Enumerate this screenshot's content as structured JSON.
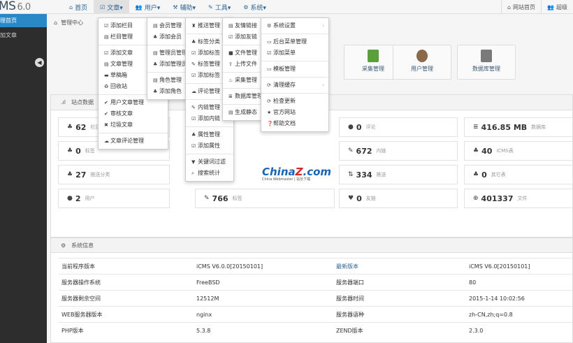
{
  "logo": {
    "name": "MS",
    "version": "6.0"
  },
  "topnav": [
    {
      "icon": "⌂",
      "label": "首页",
      "active": false
    },
    {
      "icon": "☑",
      "label": "文章▾",
      "active": true
    },
    {
      "icon": "👥",
      "label": "用户▾",
      "active": false
    },
    {
      "icon": "⚒",
      "label": "辅助▾",
      "active": false
    },
    {
      "icon": "✎",
      "label": "工具▾",
      "active": false
    },
    {
      "icon": "⚙",
      "label": "系统▾",
      "active": false
    }
  ],
  "topright": [
    {
      "icon": "⌂",
      "label": "网站首页"
    },
    {
      "icon": "👥",
      "label": "超级"
    }
  ],
  "sidebar": [
    {
      "label": "理首页",
      "active": true
    },
    {
      "label": "加文章",
      "active": false
    }
  ],
  "breadcrumb": "管理中心",
  "tiles": [
    {
      "label": "采集管理",
      "color": "#5a9f3c"
    },
    {
      "label": "用户管理",
      "color": "#8a6a4a"
    },
    {
      "label": "数据库管理",
      "color": "#7a7a7a"
    }
  ],
  "stats_panel_title": "站点数据",
  "stats": [
    {
      "icon": "♣",
      "value": "62",
      "label": "栏目"
    },
    {
      "icon": "●",
      "value": "0",
      "label": "评论"
    },
    {
      "icon": "≣",
      "value": "416.85 MB",
      "label": "数据库"
    },
    {
      "icon": "♣",
      "value": "0",
      "label": "标签"
    },
    {
      "icon": "✎",
      "value": "672",
      "label": "内链"
    },
    {
      "icon": "♣",
      "value": "40",
      "label": "iCMS表"
    },
    {
      "icon": "♣",
      "value": "27",
      "label": "推送分类"
    },
    {
      "icon": "⇅",
      "value": "334",
      "label": "推送"
    },
    {
      "icon": "♣",
      "value": "0",
      "label": "其它表"
    },
    {
      "icon": "●",
      "value": "2",
      "label": "用户"
    },
    {
      "icon": "✎",
      "value": "766",
      "label": "标签"
    },
    {
      "icon": "♥",
      "value": "0",
      "label": "友链"
    },
    {
      "icon": "⊕",
      "value": "401337",
      "label": "文件"
    }
  ],
  "sysinfo_title": "系统信息",
  "sysinfo": [
    [
      "当前程序版本",
      "iCMS V6.0.0[20150101]",
      "最新版本",
      "iCMS V6.0[20150101]"
    ],
    [
      "服务器操作系统",
      "FreeBSD",
      "服务器端口",
      "80"
    ],
    [
      "服务器剩余空间",
      "12512M",
      "服务器时间",
      "2015-1-14 10:02:56"
    ],
    [
      "WEB服务器版本",
      "nginx",
      "服务器语种",
      "zh-CN,zh;q=0.8"
    ],
    [
      "PHP版本",
      "5.3.8",
      "ZEND版本",
      "2.3.0"
    ]
  ],
  "menus": {
    "article": [
      {
        "icon": "☑",
        "label": "添加栏目"
      },
      {
        "icon": "▤",
        "label": "栏目管理"
      },
      {
        "sep": true
      },
      {
        "icon": "☑",
        "label": "添加文章"
      },
      {
        "icon": "▤",
        "label": "文章管理"
      },
      {
        "icon": "▬",
        "label": "草稿箱"
      },
      {
        "icon": "♻",
        "label": "回收站"
      },
      {
        "sep": true
      },
      {
        "icon": "✔",
        "label": "用户文章管理"
      },
      {
        "icon": "✔",
        "label": "审核文章"
      },
      {
        "icon": "✖",
        "label": "垃圾文章"
      },
      {
        "sep": true
      },
      {
        "icon": "☁",
        "label": "文章评论管理"
      }
    ],
    "user": [
      {
        "icon": "▤",
        "label": "会员管理"
      },
      {
        "icon": "♣",
        "label": "添加会员"
      },
      {
        "sep": true
      },
      {
        "icon": "▤",
        "label": "管理员管理"
      },
      {
        "icon": "♣",
        "label": "添加管理员"
      },
      {
        "sep": true
      },
      {
        "icon": "▤",
        "label": "角色管理"
      },
      {
        "icon": "♣",
        "label": "添加角色"
      }
    ],
    "helper": [
      {
        "icon": "♜",
        "label": "推送管理"
      },
      {
        "sep": true
      },
      {
        "icon": "♣",
        "label": "标签分类"
      },
      {
        "icon": "☑",
        "label": "添加标签"
      },
      {
        "icon": "✎",
        "label": "标签管理"
      },
      {
        "icon": "☑",
        "label": "添加标签"
      },
      {
        "sep": true
      },
      {
        "icon": "☁",
        "label": "评论管理"
      },
      {
        "sep": true
      },
      {
        "icon": "✎",
        "label": "内链管理"
      },
      {
        "icon": "☑",
        "label": "添加内链"
      },
      {
        "sep": true
      },
      {
        "icon": "♣",
        "label": "属性管理"
      },
      {
        "icon": "☑",
        "label": "添加属性"
      },
      {
        "sep": true
      },
      {
        "icon": "▼",
        "label": "关键词过滤"
      },
      {
        "icon": "⌕",
        "label": "搜索统计"
      }
    ],
    "tools": [
      {
        "icon": "▤",
        "label": "友情链接"
      },
      {
        "icon": "☑",
        "label": "添加友链"
      },
      {
        "sep": true
      },
      {
        "icon": "■",
        "label": "文件管理"
      },
      {
        "icon": "⇧",
        "label": "上传文件"
      },
      {
        "sep": true
      },
      {
        "icon": "♨",
        "label": "采集管理"
      },
      {
        "sep": true
      },
      {
        "icon": "≣",
        "label": "数据库管理"
      },
      {
        "sep": true
      },
      {
        "icon": "▤",
        "label": "生成静态"
      }
    ],
    "system": [
      {
        "icon": "⚙",
        "label": "系统设置",
        "arrow": true
      },
      {
        "sep": true
      },
      {
        "icon": "▭",
        "label": "后台菜单管理"
      },
      {
        "icon": "☑",
        "label": "添加菜单"
      },
      {
        "sep": true
      },
      {
        "icon": "▭",
        "label": "模板管理"
      },
      {
        "sep": true
      },
      {
        "icon": "⟳",
        "label": "清理缓存",
        "arrow": true
      },
      {
        "sep": true
      },
      {
        "icon": "⟳",
        "label": "检查更新"
      },
      {
        "icon": "★",
        "label": "官方网站"
      },
      {
        "icon": "❓",
        "label": "帮助文档"
      }
    ]
  },
  "watermark": {
    "brand_a": "China",
    "brand_z": "Z",
    "brand_b": ".com",
    "sub": "China Webmaster | 站长下载"
  },
  "colors": {
    "accent": "#2a88c6",
    "sidebar": "#2d2d2d",
    "link": "#2a6496"
  }
}
